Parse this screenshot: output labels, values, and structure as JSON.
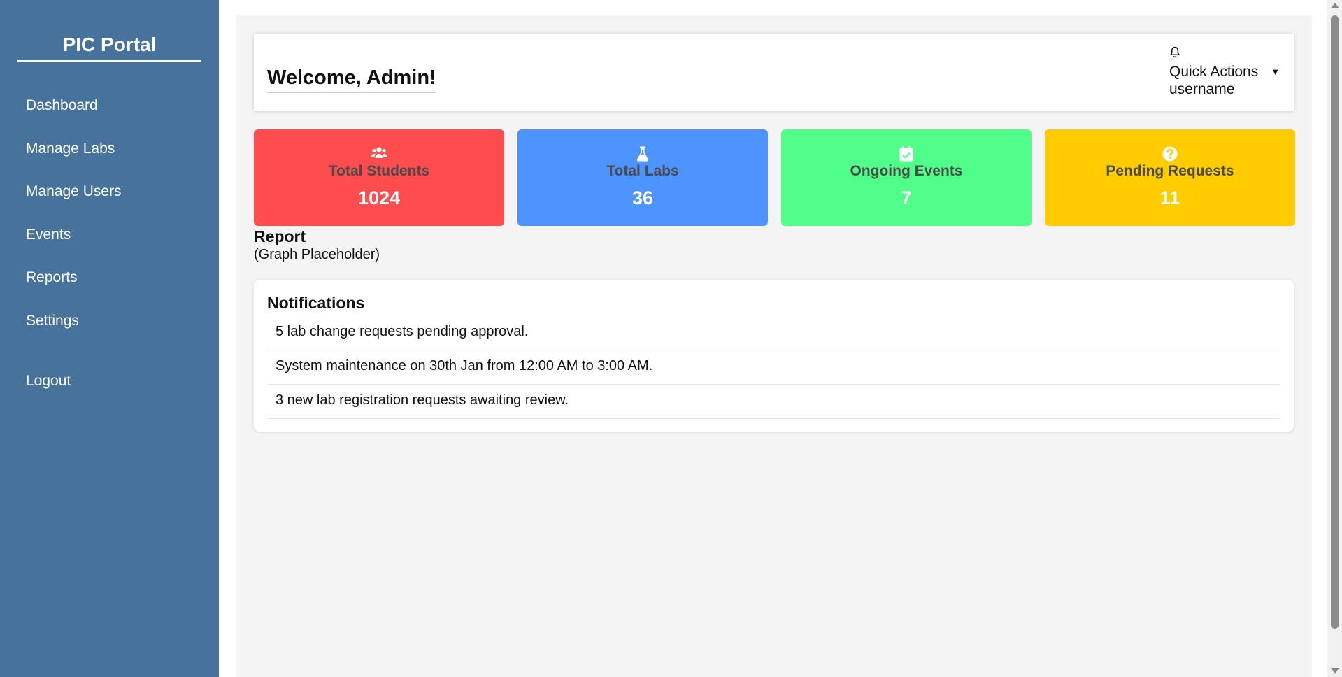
{
  "sidebar": {
    "brand": "PIC Portal",
    "items": [
      {
        "label": "Dashboard"
      },
      {
        "label": "Manage Labs"
      },
      {
        "label": "Manage Users"
      },
      {
        "label": "Events"
      },
      {
        "label": "Reports"
      },
      {
        "label": "Settings"
      }
    ],
    "logout_label": "Logout"
  },
  "header": {
    "welcome": "Welcome, Admin!",
    "quick_actions_label": "Quick Actions",
    "username": "username",
    "bell_icon": "bell-icon"
  },
  "stats": [
    {
      "label": "Total Students",
      "value": "1024",
      "icon": "users-icon",
      "color": "#ff4d4f"
    },
    {
      "label": "Total Labs",
      "value": "36",
      "icon": "flask-icon",
      "color": "#4d94ff"
    },
    {
      "label": "Ongoing Events",
      "value": "7",
      "icon": "calendar-check-icon",
      "color": "#50ff8a"
    },
    {
      "label": "Pending Requests",
      "value": "11",
      "icon": "question-circle-icon",
      "color": "#ffcc00"
    }
  ],
  "report": {
    "title": "Report",
    "placeholder": "(Graph Placeholder)"
  },
  "notifications": {
    "title": "Notifications",
    "items": [
      "5 lab change requests pending approval.",
      "System maintenance on 30th Jan from 12:00 AM to 3:00 AM.",
      "3 new lab registration requests awaiting review."
    ]
  },
  "colors": {
    "sidebar_bg": "#46729b",
    "main_bg": "#f4f4f4"
  }
}
